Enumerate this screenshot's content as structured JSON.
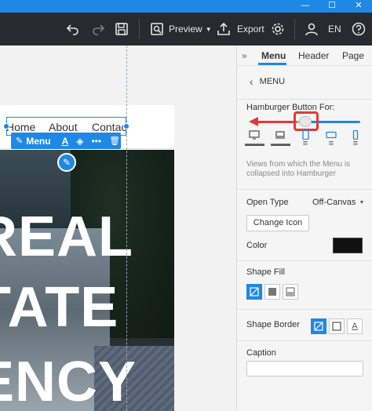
{
  "titlebar": {
    "minimize_glyph": "—",
    "maximize_glyph": "☐",
    "close_glyph": "✕",
    "accent": "#1e88e5"
  },
  "toolbar": {
    "preview_label": "Preview",
    "export_label": "Export",
    "language_label": "EN"
  },
  "canvas": {
    "menu_toolbar_label": "Menu",
    "menu_links": [
      "Home",
      "About",
      "Contac"
    ],
    "hero_lines": [
      "REAL",
      "TATE",
      "ENCY"
    ]
  },
  "panel": {
    "tabs": [
      "Menu",
      "Header",
      "Page"
    ],
    "collapse_glyph": "»",
    "back_label": "MENU",
    "hamburger_title": "Hamburger Button For:",
    "hamburger_hint": "Views from which the Menu is collapsed into Hamburger",
    "open_type_label": "Open Type",
    "open_type_value": "Off-Canvas",
    "change_icon_label": "Change Icon",
    "color_label": "Color",
    "color_value": "#111111",
    "shape_fill_label": "Shape Fill",
    "shape_border_label": "Shape Border",
    "caption_label": "Caption",
    "slider_level": 0.45
  }
}
